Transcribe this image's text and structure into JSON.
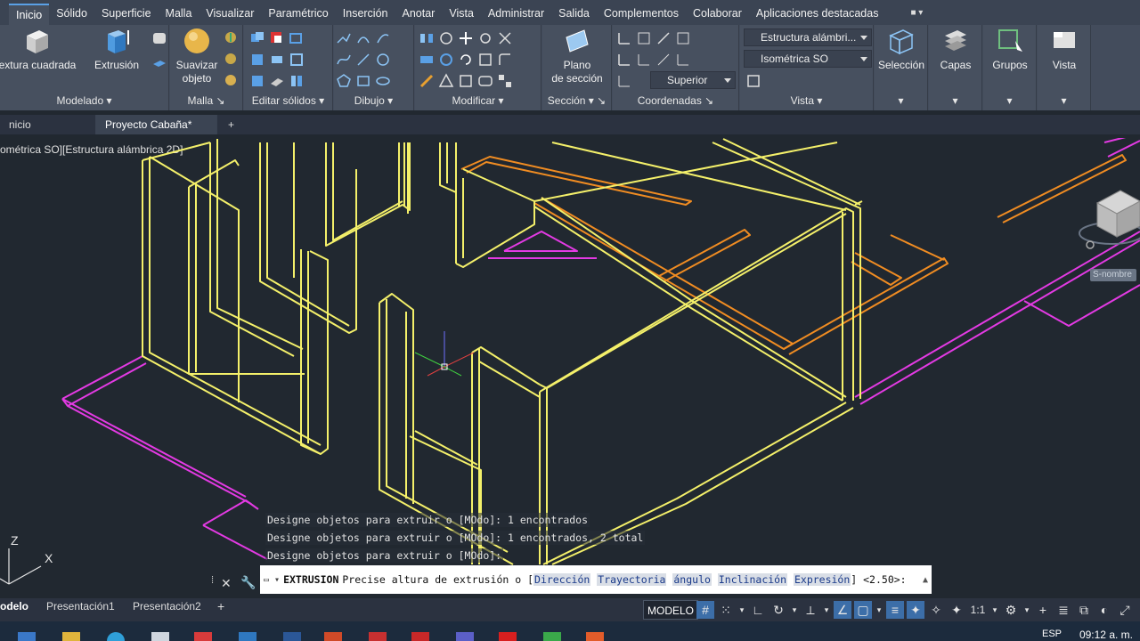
{
  "menu": {
    "tabs": [
      "Inicio",
      "Sólido",
      "Superficie",
      "Malla",
      "Visualizar",
      "Paramétrico",
      "Inserción",
      "Anotar",
      "Vista",
      "Administrar",
      "Salida",
      "Complementos",
      "Colaborar",
      "Aplicaciones destacadas"
    ],
    "active": "Inicio"
  },
  "ribbon": {
    "modelado": {
      "title": "Modelado",
      "box_label": "extura cuadrada",
      "extrusion_label": "Extrusión"
    },
    "malla": {
      "title": "Malla",
      "suavizar_line1": "Suavizar",
      "suavizar_line2": "objeto"
    },
    "editar_solidos": {
      "title": "Editar sólidos"
    },
    "dibujo": {
      "title": "Dibujo"
    },
    "modificar": {
      "title": "Modificar"
    },
    "seccion": {
      "title": "Sección",
      "plano_line1": "Plano",
      "plano_line2": "de sección"
    },
    "coordenadas": {
      "title": "Coordenadas",
      "ucs_combo": "Superior"
    },
    "vista": {
      "title": "Vista",
      "visual_style": "Estructura alámbri...",
      "view_combo": "Isométrica SO"
    },
    "seleccion_label": "Selección",
    "capas_label": "Capas",
    "grupos_label": "Grupos",
    "vista_big_label": "Vista"
  },
  "file_tabs": {
    "start": "nicio",
    "active": "Proyecto Cabaña*",
    "close_glyph": "✕",
    "add_glyph": "+"
  },
  "viewport": {
    "label": "ométrica SO][Estructura alámbrica 2D]",
    "viewcube_tooltip": "S-nombre",
    "ucs_x": "X",
    "ucs_z": "Z"
  },
  "command": {
    "history": [
      "Designe objetos para extruir o [MOdo]: 1 encontrados",
      "Designe objetos para extruir o [MOdo]: 1 encontrados, 2 total",
      "Designe objetos para extruir o [MOdo]:"
    ],
    "name": "EXTRUSION",
    "prompt": "Precise altura de extrusión o [",
    "options": [
      "Dirección",
      "Trayectoria",
      "ángulo",
      "Inclinación",
      "Expresión"
    ],
    "default": "] <2.50>:"
  },
  "layout_tabs": [
    "odelo",
    "Presentación1",
    "Presentación2"
  ],
  "layout_add": "+",
  "status": {
    "space": "MODELO",
    "scale": "1:1"
  },
  "taskbar": {
    "language": "ESP",
    "time": "09:12 a. m."
  },
  "colors": {
    "yellow": "#f4f06a",
    "magenta": "#e33ae3",
    "orange": "#f08c22",
    "background": "#212830"
  }
}
